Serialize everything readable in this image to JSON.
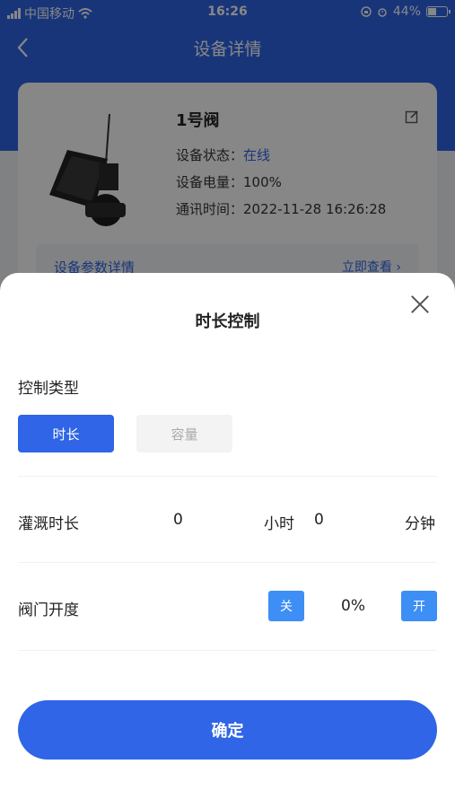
{
  "status_bar": {
    "carrier": "中国移动",
    "time": "16:26",
    "battery": "44%"
  },
  "navbar": {
    "back_icon": "chevron-left-icon",
    "title": "设备详情"
  },
  "device": {
    "name": "1号阀",
    "status_label": "设备状态：",
    "status_value": "在线",
    "battery_label": "设备电量：",
    "battery_value": "100%",
    "comm_label": "通讯时间：",
    "comm_value": "2022-11-28 16:26:28",
    "params_link": "设备参数详情",
    "view_now": "立即查看",
    "image_icon": "solar-valve-image"
  },
  "sheet": {
    "title": "时长控制",
    "control_type_label": "控制类型",
    "type_options": [
      "时长",
      "容量"
    ],
    "selected_type": "时长",
    "irrigation_label": "灌溉时长",
    "hours_value": "0",
    "hours_unit": "小时",
    "minutes_value": "0",
    "minutes_unit": "分钟",
    "valve_label": "阀门开度",
    "off_label": "关",
    "opening_value": "0%",
    "on_label": "开",
    "confirm_label": "确定"
  },
  "colors": {
    "primary": "#2f65e6",
    "button_light": "#3d8ef5"
  }
}
